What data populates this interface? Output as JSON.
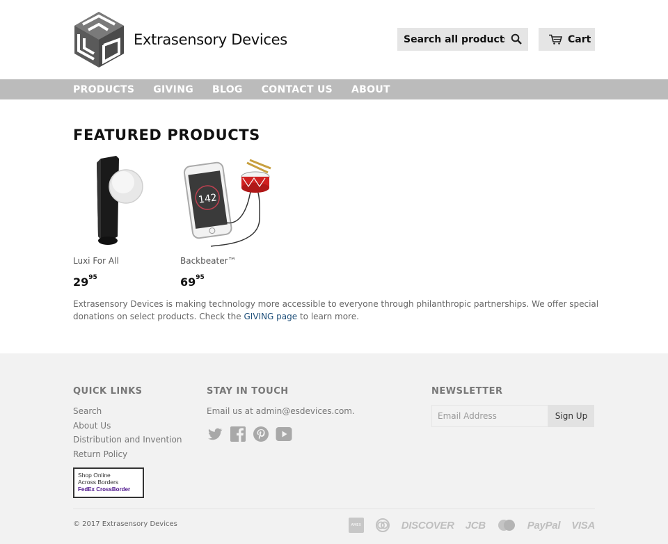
{
  "site": {
    "name": "Extrasensory Devices"
  },
  "header": {
    "search_placeholder": "Search all products...",
    "cart_label": "Cart"
  },
  "nav": {
    "items": [
      "PRODUCTS",
      "GIVING",
      "BLOG",
      "CONTACT US",
      "ABOUT"
    ]
  },
  "main": {
    "featured_title": "FEATURED PRODUCTS",
    "products": [
      {
        "name": "Luxi For All",
        "price_main": "29",
        "price_cents": "95"
      },
      {
        "name": "Backbeater™",
        "price_main": "69",
        "price_cents": "95"
      }
    ],
    "blurb_before": "Extrasensory Devices is making technology more accessible to everyone through philanthropic partnerships. We offer special donations on select products. Check the ",
    "blurb_link": "GIVING page",
    "blurb_after": " to learn more."
  },
  "footer": {
    "quick_links_title": "QUICK LINKS",
    "quick_links": [
      "Search",
      "About Us",
      "Distribution and Invention",
      "Return Policy"
    ],
    "fedex_badge": [
      "Shop Online",
      "Across Borders",
      "FedEx CrossBorder"
    ],
    "stay_title": "STAY IN TOUCH",
    "stay_text": "Email us at admin@esdevices.com.",
    "social_icons": [
      "twitter-icon",
      "facebook-icon",
      "pinterest-icon",
      "youtube-icon"
    ],
    "newsletter_title": "NEWSLETTER",
    "email_placeholder": "Email Address",
    "signup_label": "Sign Up",
    "copyright": "© 2017 Extrasensory Devices",
    "payment_methods": [
      "DISCOVER",
      "JCB",
      "PayPal",
      "VISA"
    ]
  },
  "colors": {
    "nav_bg": "#bbbbbb",
    "footer_bg": "#f2f2f2",
    "link": "#1e4f7a"
  }
}
